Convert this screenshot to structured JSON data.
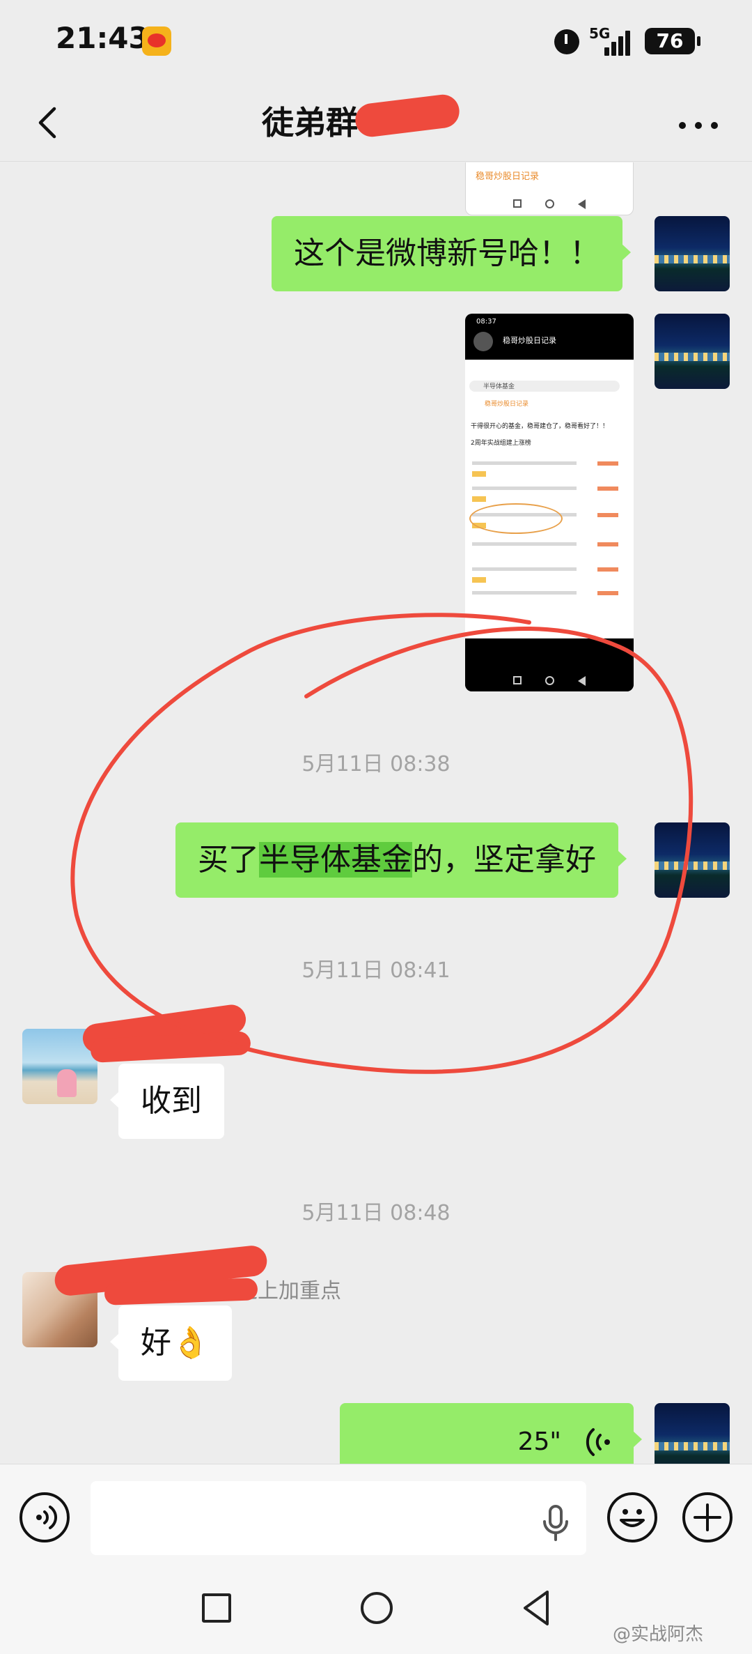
{
  "status_bar": {
    "time": "21:43",
    "network": "5G",
    "battery": "76"
  },
  "header": {
    "title": "徒弟群"
  },
  "messages": {
    "m1_text": "这个是微博新号哈！！",
    "image_top_label": "稳哥炒股日记录",
    "screenshot": {
      "time": "08:37",
      "account": "稳哥炒股日记录",
      "search": "半导体基金",
      "line1": "干得很开心的基金，稳哥建仓了，稳哥看好了！！",
      "line2": "2周年实战组建上涨榜"
    },
    "ts1": "5月11日 08:38",
    "m2_pre": "买了",
    "m2_highlight": "半导体基金",
    "m2_post": "的，坚定拿好",
    "ts2": "5月11日 08:41",
    "m3_text": "收到",
    "ts3": "5月11日 08:48",
    "m4_sender": "之上加重点",
    "m4_text": "好👌",
    "m5_duration": "25\""
  },
  "input": {
    "placeholder": ""
  },
  "watermark": "@实战阿杰",
  "colors": {
    "bubble_out": "#95ec69",
    "bubble_in": "#ffffff",
    "highlight": "#5fcc3e",
    "annotation": "#ee4a3d",
    "background": "#ededed"
  },
  "icons": [
    "back-icon",
    "more-icon",
    "voice-wave-icon",
    "microphone-icon",
    "emoji-icon",
    "plus-icon",
    "nav-square-icon",
    "nav-home-icon",
    "nav-back-icon",
    "alarm-icon",
    "signal-icon"
  ]
}
